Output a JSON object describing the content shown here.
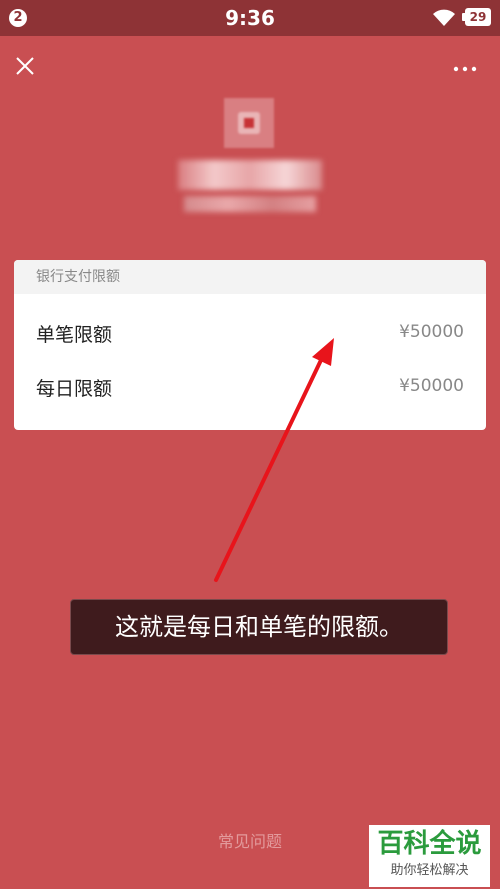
{
  "status_bar": {
    "notification_count": "2",
    "time": "9:36",
    "battery": "29",
    "icons": [
      "wifi-icon",
      "battery-icon"
    ]
  },
  "header": {
    "icons": [
      "close-icon",
      "more-icon"
    ]
  },
  "limits_card": {
    "header": "银行支付限额",
    "rows": [
      {
        "label": "单笔限额",
        "value": "¥50000"
      },
      {
        "label": "每日限额",
        "value": "¥50000"
      }
    ]
  },
  "annotation": {
    "caption": "这就是每日和单笔的限额。",
    "arrow_color": "#e8141b"
  },
  "footer": {
    "faq": "常见问题"
  },
  "watermark": {
    "title": "百科全说",
    "subtitle": "助你轻松解决"
  },
  "colors": {
    "background": "#c94f52",
    "status_bar": "#8e3336",
    "card": "#ffffff",
    "caption_bg": "#3f1b1d"
  }
}
